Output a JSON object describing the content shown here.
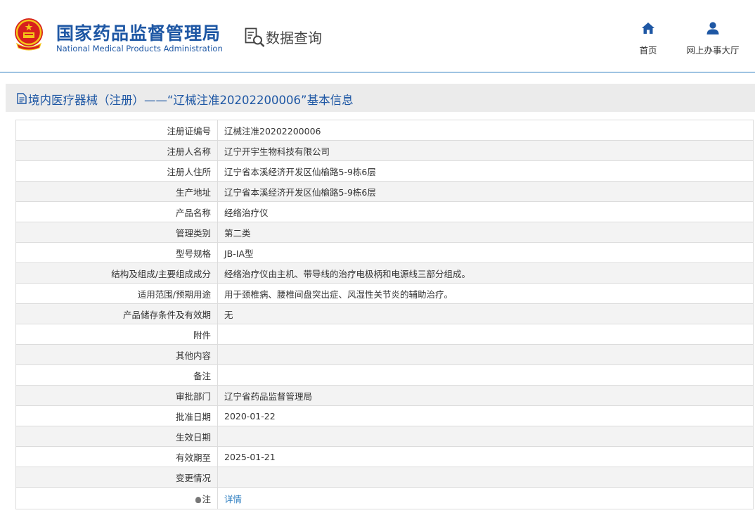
{
  "header": {
    "logo_cn": "国家药品监督管理局",
    "logo_en": "National Medical Products Administration",
    "query_title": "数据查询",
    "nav": {
      "home_label": "首页",
      "service_hall_label": "网上办事大厅"
    },
    "colors": {
      "brand": "#1e57a4",
      "accent_line": "#2f7fc1",
      "emblem_red": "#d7201d",
      "emblem_gold": "#f5c518"
    }
  },
  "page_title": "境内医疗器械（注册）——“辽械注准20202200006”基本信息",
  "records": [
    {
      "label": "注册证编号",
      "value": "辽械注准20202200006"
    },
    {
      "label": "注册人名称",
      "value": "辽宁开宇生物科技有限公司"
    },
    {
      "label": "注册人住所",
      "value": "辽宁省本溪经济开发区仙榆路5-9栋6层"
    },
    {
      "label": "生产地址",
      "value": "辽宁省本溪经济开发区仙榆路5-9栋6层"
    },
    {
      "label": "产品名称",
      "value": "经络治疗仪"
    },
    {
      "label": "管理类别",
      "value": "第二类"
    },
    {
      "label": "型号规格",
      "value": "JB-IA型"
    },
    {
      "label": "结构及组成/主要组成成分",
      "value": "经络治疗仪由主机、带导线的治疗电极柄和电源线三部分组成。"
    },
    {
      "label": "适用范围/预期用途",
      "value": "用于颈椎病、腰椎间盘突出症、风湿性关节炎的辅助治疗。"
    },
    {
      "label": "产品储存条件及有效期",
      "value": "无"
    },
    {
      "label": "附件",
      "value": ""
    },
    {
      "label": "其他内容",
      "value": ""
    },
    {
      "label": "备注",
      "value": ""
    },
    {
      "label": "审批部门",
      "value": "辽宁省药品监督管理局"
    },
    {
      "label": "批准日期",
      "value": "2020-01-22"
    },
    {
      "label": "生效日期",
      "value": ""
    },
    {
      "label": "有效期至",
      "value": "2025-01-21"
    },
    {
      "label": "变更情况",
      "value": ""
    }
  ],
  "note": {
    "label": "注",
    "link_text": "详情",
    "icon": "lightbulb-icon"
  }
}
